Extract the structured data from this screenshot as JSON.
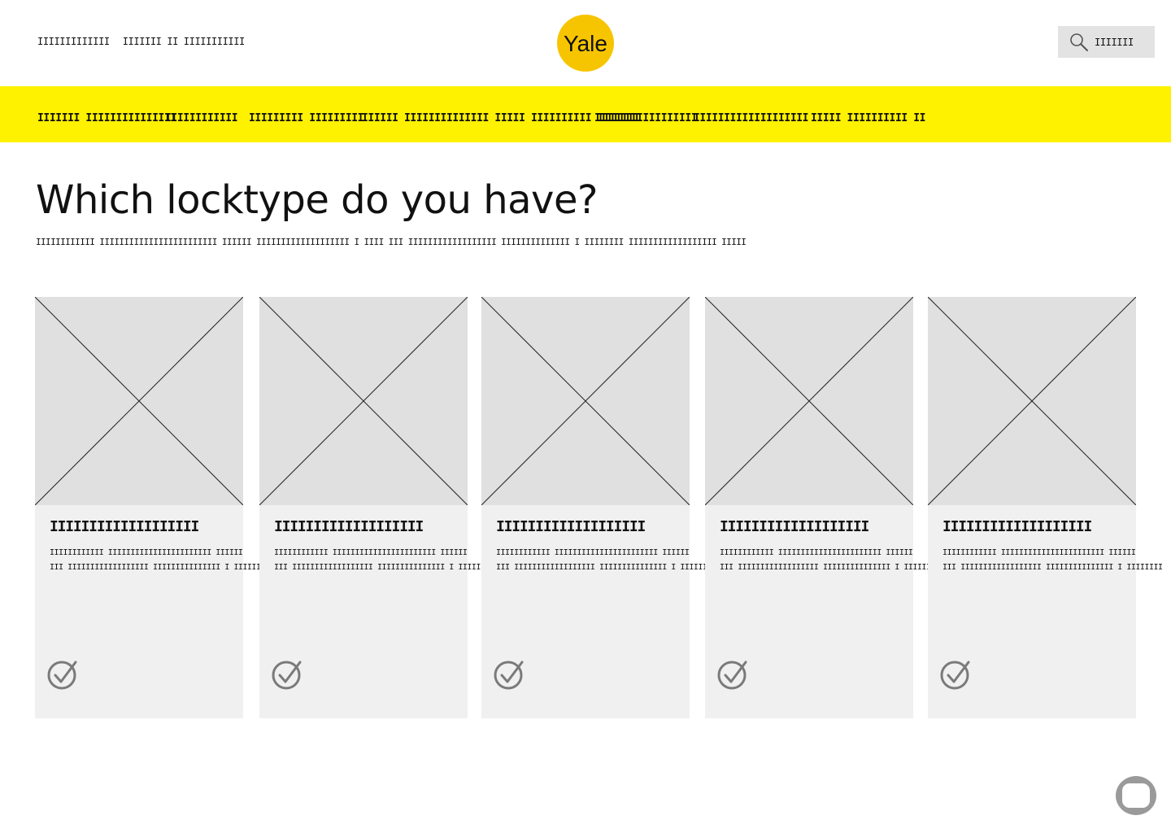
{
  "header": {
    "util_links": [
      "IIIIIIIIIIIII",
      "IIIIIII II IIIIIIIIIII"
    ],
    "logo_text": "Yale",
    "search_placeholder": "IIIIIII"
  },
  "nav": {
    "items": [
      "IIIIIII IIIIIIIIIIIIIII",
      "IIIIIIIIIIII",
      "IIIIIIIII IIIIIIIII",
      "IIIIII IIIIIIIIIIIIII IIIII IIIIIIIIII IIIIIII",
      "IIIIIIIIIIIIIIIII",
      "IIIIIIIIIIIIIIIIIII",
      "IIIII IIIIIIIIII II"
    ]
  },
  "main": {
    "title": "Which locktype do you have?",
    "subtitle": "IIIIIIIIIIII IIIIIIIIIIIIIIIIIIIIIIII IIIIII   IIIIIIIIIIIIIIIIIII   I IIII III IIIIIIIIIIIIIIIIII IIIIIIIIIIIIII I IIIIIIII IIIIIIIIIIIIIIIIII IIIII"
  },
  "cards": [
    {
      "title": "IIIIIIIIIIIIIIIIIII",
      "desc_line1": "IIIIIIIIIIII IIIIIIIIIIIIIIIIIIIIIII IIIIII",
      "desc_line2": "III IIIIIIIIIIIIIIIIII IIIIIIIIIIIIIII I IIIIIIII",
      "selected": false
    },
    {
      "title": "IIIIIIIIIIIIIIIIIII",
      "desc_line1": "IIIIIIIIIIII IIIIIIIIIIIIIIIIIIIIIII IIIIII",
      "desc_line2": "III IIIIIIIIIIIIIIIIII IIIIIIIIIIIIIII I IIIIIIII",
      "selected": false
    },
    {
      "title": "IIIIIIIIIIIIIIIIIII",
      "desc_line1": "IIIIIIIIIIII IIIIIIIIIIIIIIIIIIIIIII IIIIII",
      "desc_line2": "III IIIIIIIIIIIIIIIIII IIIIIIIIIIIIIII I IIIIIIII",
      "selected": false
    },
    {
      "title": "IIIIIIIIIIIIIIIIIII",
      "desc_line1": "IIIIIIIIIIII IIIIIIIIIIIIIIIIIIIIIII IIIIII",
      "desc_line2": "III IIIIIIIIIIIIIIIIII IIIIIIIIIIIIIII I IIIIIIII",
      "selected": false
    },
    {
      "title": "IIIIIIIIIIIIIIIIIII",
      "desc_line1": "IIIIIIIIIIII IIIIIIIIIIIIIIIIIIIIIII IIIIII",
      "desc_line2": "III IIIIIIIIIIIIIIIIII IIIIIIIIIIIIIII I IIIIIIII",
      "selected": false
    }
  ],
  "colors": {
    "nav_bg": "#fff200",
    "logo_bg": "#f7c500",
    "card_bg": "#f0f0f0",
    "placeholder_bg": "#e0e0e0",
    "check_icon": "#7a7a7a"
  },
  "icons": {
    "search": "search-icon",
    "check": "check-circle-icon",
    "chat": "chat-bubble-icon",
    "image_placeholder": "image-placeholder-icon"
  }
}
